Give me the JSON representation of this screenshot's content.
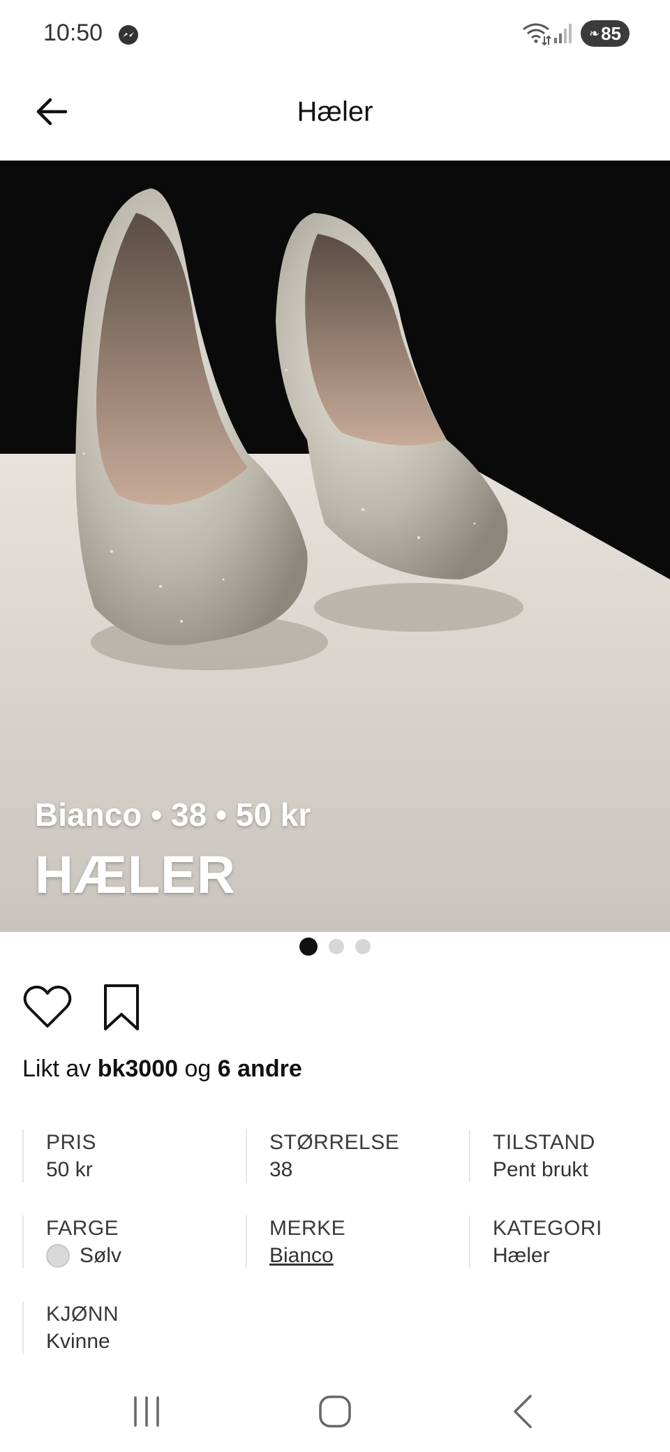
{
  "status_bar": {
    "time": "10:50",
    "battery": "85",
    "icons": [
      "messenger-icon",
      "wifi-icon",
      "signal-icon",
      "battery-saver-icon"
    ]
  },
  "header": {
    "title": "Hæler",
    "back_icon": "arrow-left-icon"
  },
  "hero": {
    "meta": "Bianco • 38 • 50 kr",
    "title": "HÆLER"
  },
  "carousel": {
    "count": 3,
    "active_index": 0
  },
  "actions": {
    "like_icon": "heart-outline-icon",
    "save_icon": "bookmark-outline-icon"
  },
  "likes": {
    "prefix": "Likt av",
    "user": "bk3000",
    "joiner": "og",
    "others": "6 andre"
  },
  "attributes": {
    "price": {
      "label": "PRIS",
      "value": "50 kr"
    },
    "size": {
      "label": "STØRRELSE",
      "value": "38"
    },
    "condition": {
      "label": "TILSTAND",
      "value": "Pent brukt"
    },
    "color": {
      "label": "FARGE",
      "value": "Sølv",
      "swatch": "#d9d9d9"
    },
    "brand": {
      "label": "MERKE",
      "value": "Bianco"
    },
    "category": {
      "label": "KATEGORI",
      "value": "Hæler"
    },
    "gender": {
      "label": "KJØNN",
      "value": "Kvinne"
    }
  },
  "nav_bar": {
    "icons": [
      "recent-apps-icon",
      "home-icon",
      "back-icon"
    ]
  }
}
